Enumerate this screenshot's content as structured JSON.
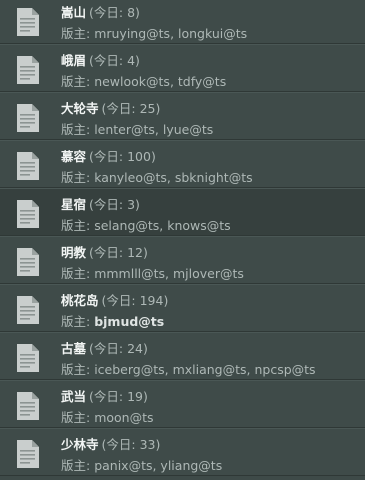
{
  "labels": {
    "today_prefix": "(今日: ",
    "today_suffix": ")",
    "moderator_prefix": "版主: "
  },
  "colors": {
    "background": "#3e4a48",
    "row_highlight": "#36403e",
    "title_text": "#f2f5f4",
    "muted_text": "#aeb8b6",
    "icon": "#c9cecd"
  },
  "forums": [
    {
      "name": "嵩山",
      "today": "8",
      "moderators": "mruying@ts, longkui@ts",
      "icon": "document-icon"
    },
    {
      "name": "峨眉",
      "today": "4",
      "moderators": "newlook@ts, tdfy@ts",
      "icon": "document-icon"
    },
    {
      "name": "大轮寺",
      "today": "25",
      "moderators": "lenter@ts, lyue@ts",
      "icon": "document-icon"
    },
    {
      "name": "慕容",
      "today": "100",
      "moderators": "kanyleo@ts, sbknight@ts",
      "icon": "document-icon"
    },
    {
      "name": "星宿",
      "today": "3",
      "moderators": "selang@ts, knows@ts",
      "icon": "document-icon",
      "highlight": true
    },
    {
      "name": "明教",
      "today": "12",
      "moderators": "mmmlll@ts, mjlover@ts",
      "icon": "document-icon"
    },
    {
      "name": "桃花岛",
      "today": "194",
      "moderators": "bjmud@ts",
      "icon": "document-icon",
      "bold_moderators": true
    },
    {
      "name": "古墓",
      "today": "24",
      "moderators": "iceberg@ts, mxliang@ts, npcsp@ts",
      "icon": "document-icon"
    },
    {
      "name": "武当",
      "today": "19",
      "moderators": "moon@ts",
      "icon": "document-icon"
    },
    {
      "name": "少林寺",
      "today": "33",
      "moderators": "panix@ts, yliang@ts",
      "icon": "document-icon"
    }
  ]
}
